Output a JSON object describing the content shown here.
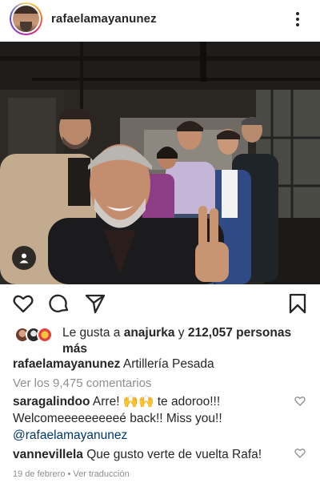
{
  "header": {
    "username": "rafaelamayanunez",
    "avatar_icon": "profile-photo",
    "more_icon": "more-vertical-icon"
  },
  "post": {
    "image_description_icon": "group-selfie-photo",
    "user_tag_icon": "person-tag-icon"
  },
  "actions": {
    "like_icon": "heart-icon",
    "comment_icon": "comment-bubble-icon",
    "share_icon": "send-paper-plane-icon",
    "save_icon": "bookmark-icon"
  },
  "likes": {
    "prefix": "Le gusta a ",
    "first_user": "anajurka",
    "connector": " y ",
    "count_text": "212,057 personas",
    "suffix": "más"
  },
  "caption": {
    "username": "rafaelamayanunez",
    "text": "Artillería Pesada"
  },
  "view_comments": "Ver los 9,475 comentarios",
  "comments": [
    {
      "username": "saragalindoo",
      "text_part1": "Arre! 🙌🙌 te adoroo!!!",
      "text_part2": "Welcomeeeeeeeeeé back!! Miss you!!",
      "mention": "@rafaelamayanunez"
    },
    {
      "username": "vannevillela",
      "text": "Que gusto verte de vuelta Rafa!"
    }
  ],
  "meta": {
    "date": "19 de febrero",
    "separator": " • ",
    "translate": "Ver traducción"
  },
  "colors": {
    "text": "#262626",
    "secondary": "#8e8e8e",
    "link": "#00376b"
  }
}
